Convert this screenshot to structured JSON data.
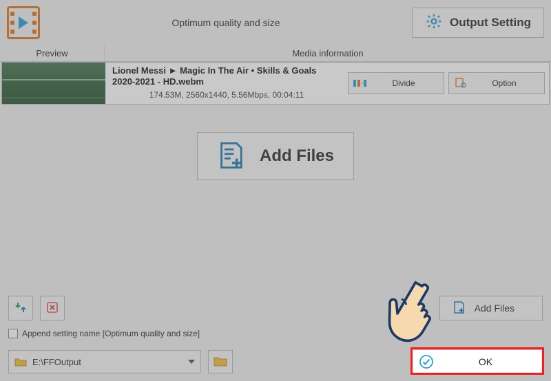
{
  "topbar": {
    "quality_label": "Optimum quality and size",
    "output_setting_label": "Output Setting"
  },
  "headers": {
    "preview": "Preview",
    "media_info": "Media information"
  },
  "media_item": {
    "title": "Lionel Messi ► Magic In The Air • Skills & Goals 2020-2021 - HD.webm",
    "meta": "174.53M, 2560x1440, 5.56Mbps, 00:04:11",
    "divide_label": "Divide",
    "option_label": "Option"
  },
  "add_files_big": "Add Files",
  "bottom": {
    "add_files_small": "Add Files",
    "append_checkbox_label": "Append setting name [Optimum quality and size]",
    "output_path": "E:\\FFOutput",
    "ok_label": "OK"
  }
}
